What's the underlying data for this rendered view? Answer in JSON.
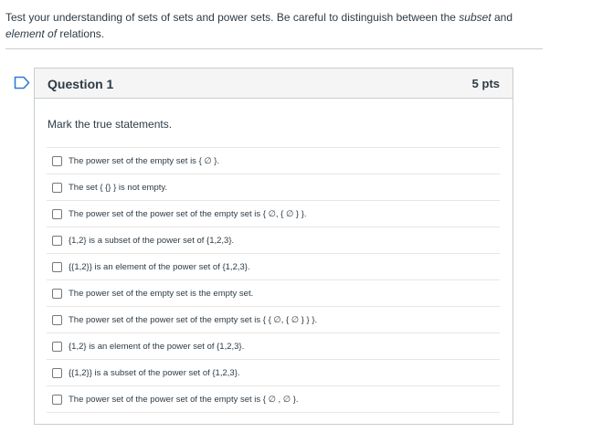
{
  "intro": {
    "part1": "Test your understanding of sets of sets and power sets. Be careful to distinguish between the ",
    "em1": "subset",
    "part2": " and ",
    "em2": "element of",
    "part3": " relations."
  },
  "question": {
    "title": "Question 1",
    "points": "5 pts",
    "prompt": "Mark the true statements.",
    "answers": [
      "The power set of the empty set is { ∅ }.",
      "The set { {} } is not empty.",
      "The power set of the power set of the empty set is { ∅, { ∅ } }.",
      "{1,2} is a subset of the power set of {1,2,3}.",
      "{{1,2}} is an element of the power set of {1,2,3}.",
      "The power set of the empty set is the empty set.",
      "The power set of the power set of the empty set is { { ∅, { ∅ } } }.",
      "{1,2} is an element of the power set of {1,2,3}.",
      "{{1,2}} is a subset of the power set of {1,2,3}.",
      "The power set of the power set of the empty set is { ∅ , ∅ }."
    ]
  },
  "colors": {
    "text": "#2d3b45",
    "border": "#c7cdd1",
    "header_bg": "#f5f5f5",
    "flag": "#2d7bd5"
  },
  "icons": {
    "flag": "flag-icon"
  }
}
